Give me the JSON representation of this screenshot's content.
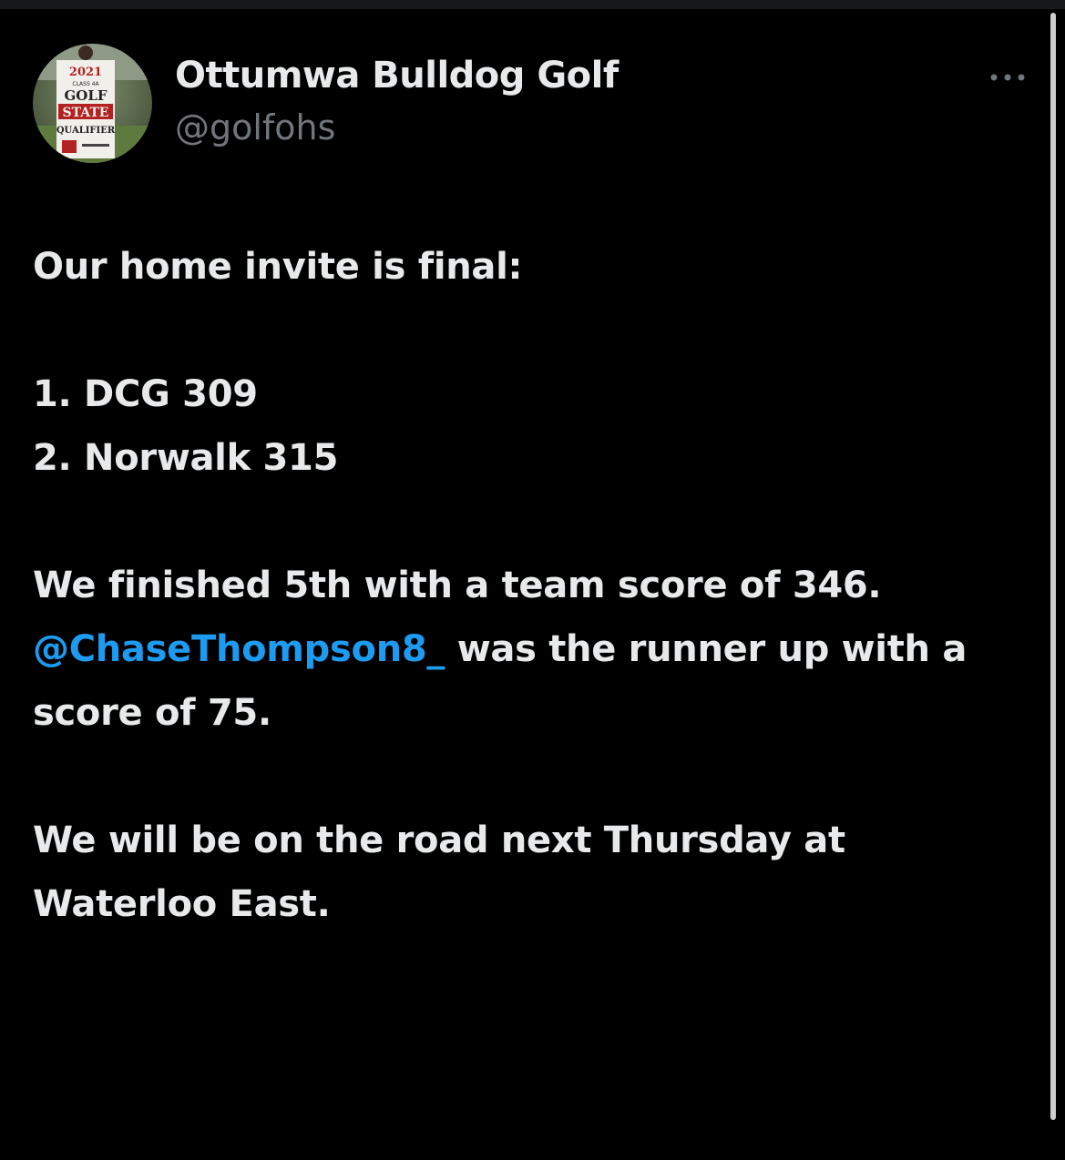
{
  "colors": {
    "background": "#000000",
    "text": "#e7e9ea",
    "secondary_text": "#71767b",
    "link": "#1d9bf0"
  },
  "author": {
    "display_name": "Ottumwa Bulldog Golf",
    "handle": "@golfohs",
    "avatar_icon": "avatar-golf-state-qualifier-banner",
    "avatar_banner_text": [
      "2021",
      "CLASS 4A",
      "GOLF",
      "STATE",
      "QUALIFIER"
    ]
  },
  "more_icon": "more-horizontal-icon",
  "tweet": {
    "intro": "Our home invite is final:",
    "results": [
      "1. DCG 309",
      "2. Norwalk 315"
    ],
    "finish_line": "We finished 5th with a team score of 346.",
    "mention": "@ChaseThompson8_",
    "runner_up_text": " was the runner up with a score of 75.",
    "closing": "We will be on the road next Thursday at Waterloo East."
  }
}
